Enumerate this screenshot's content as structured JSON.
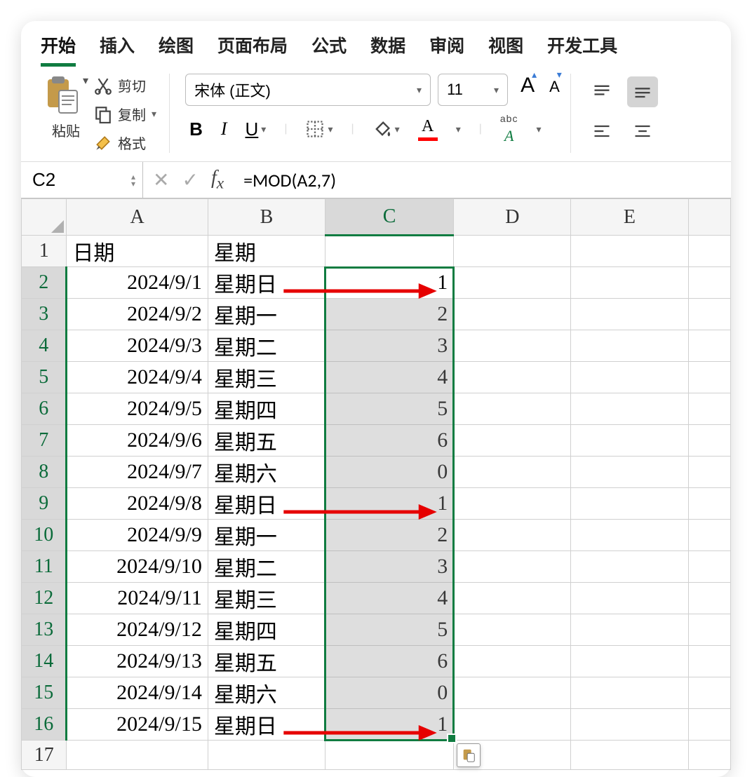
{
  "tabs": [
    "开始",
    "插入",
    "绘图",
    "页面布局",
    "公式",
    "数据",
    "审阅",
    "视图",
    "开发工具"
  ],
  "active_tab_index": 0,
  "clipboard": {
    "paste_label": "粘贴",
    "cut_label": "剪切",
    "copy_label": "复制",
    "format_painter_label": "格式"
  },
  "font": {
    "name": "宋体 (正文)",
    "size": "11"
  },
  "name_box": "C2",
  "formula": "=MOD(A2,7)",
  "columns": [
    "A",
    "B",
    "C",
    "D",
    "E"
  ],
  "active_column": "C",
  "headers": {
    "A": "日期",
    "B": "星期"
  },
  "rows": [
    {
      "n": 1
    },
    {
      "n": 2,
      "A": "2024/9/1",
      "B": "星期日",
      "C": "1",
      "arrow": true
    },
    {
      "n": 3,
      "A": "2024/9/2",
      "B": "星期一",
      "C": "2"
    },
    {
      "n": 4,
      "A": "2024/9/3",
      "B": "星期二",
      "C": "3"
    },
    {
      "n": 5,
      "A": "2024/9/4",
      "B": "星期三",
      "C": "4"
    },
    {
      "n": 6,
      "A": "2024/9/5",
      "B": "星期四",
      "C": "5"
    },
    {
      "n": 7,
      "A": "2024/9/6",
      "B": "星期五",
      "C": "6"
    },
    {
      "n": 8,
      "A": "2024/9/7",
      "B": "星期六",
      "C": "0"
    },
    {
      "n": 9,
      "A": "2024/9/8",
      "B": "星期日",
      "C": "1",
      "arrow": true
    },
    {
      "n": 10,
      "A": "2024/9/9",
      "B": "星期一",
      "C": "2"
    },
    {
      "n": 11,
      "A": "2024/9/10",
      "B": "星期二",
      "C": "3"
    },
    {
      "n": 12,
      "A": "2024/9/11",
      "B": "星期三",
      "C": "4"
    },
    {
      "n": 13,
      "A": "2024/9/12",
      "B": "星期四",
      "C": "5"
    },
    {
      "n": 14,
      "A": "2024/9/13",
      "B": "星期五",
      "C": "6"
    },
    {
      "n": 15,
      "A": "2024/9/14",
      "B": "星期六",
      "C": "0"
    },
    {
      "n": 16,
      "A": "2024/9/15",
      "B": "星期日",
      "C": "1",
      "arrow": true
    },
    {
      "n": 17
    }
  ],
  "selection": {
    "from_row": 2,
    "to_row": 16,
    "column": "C"
  }
}
